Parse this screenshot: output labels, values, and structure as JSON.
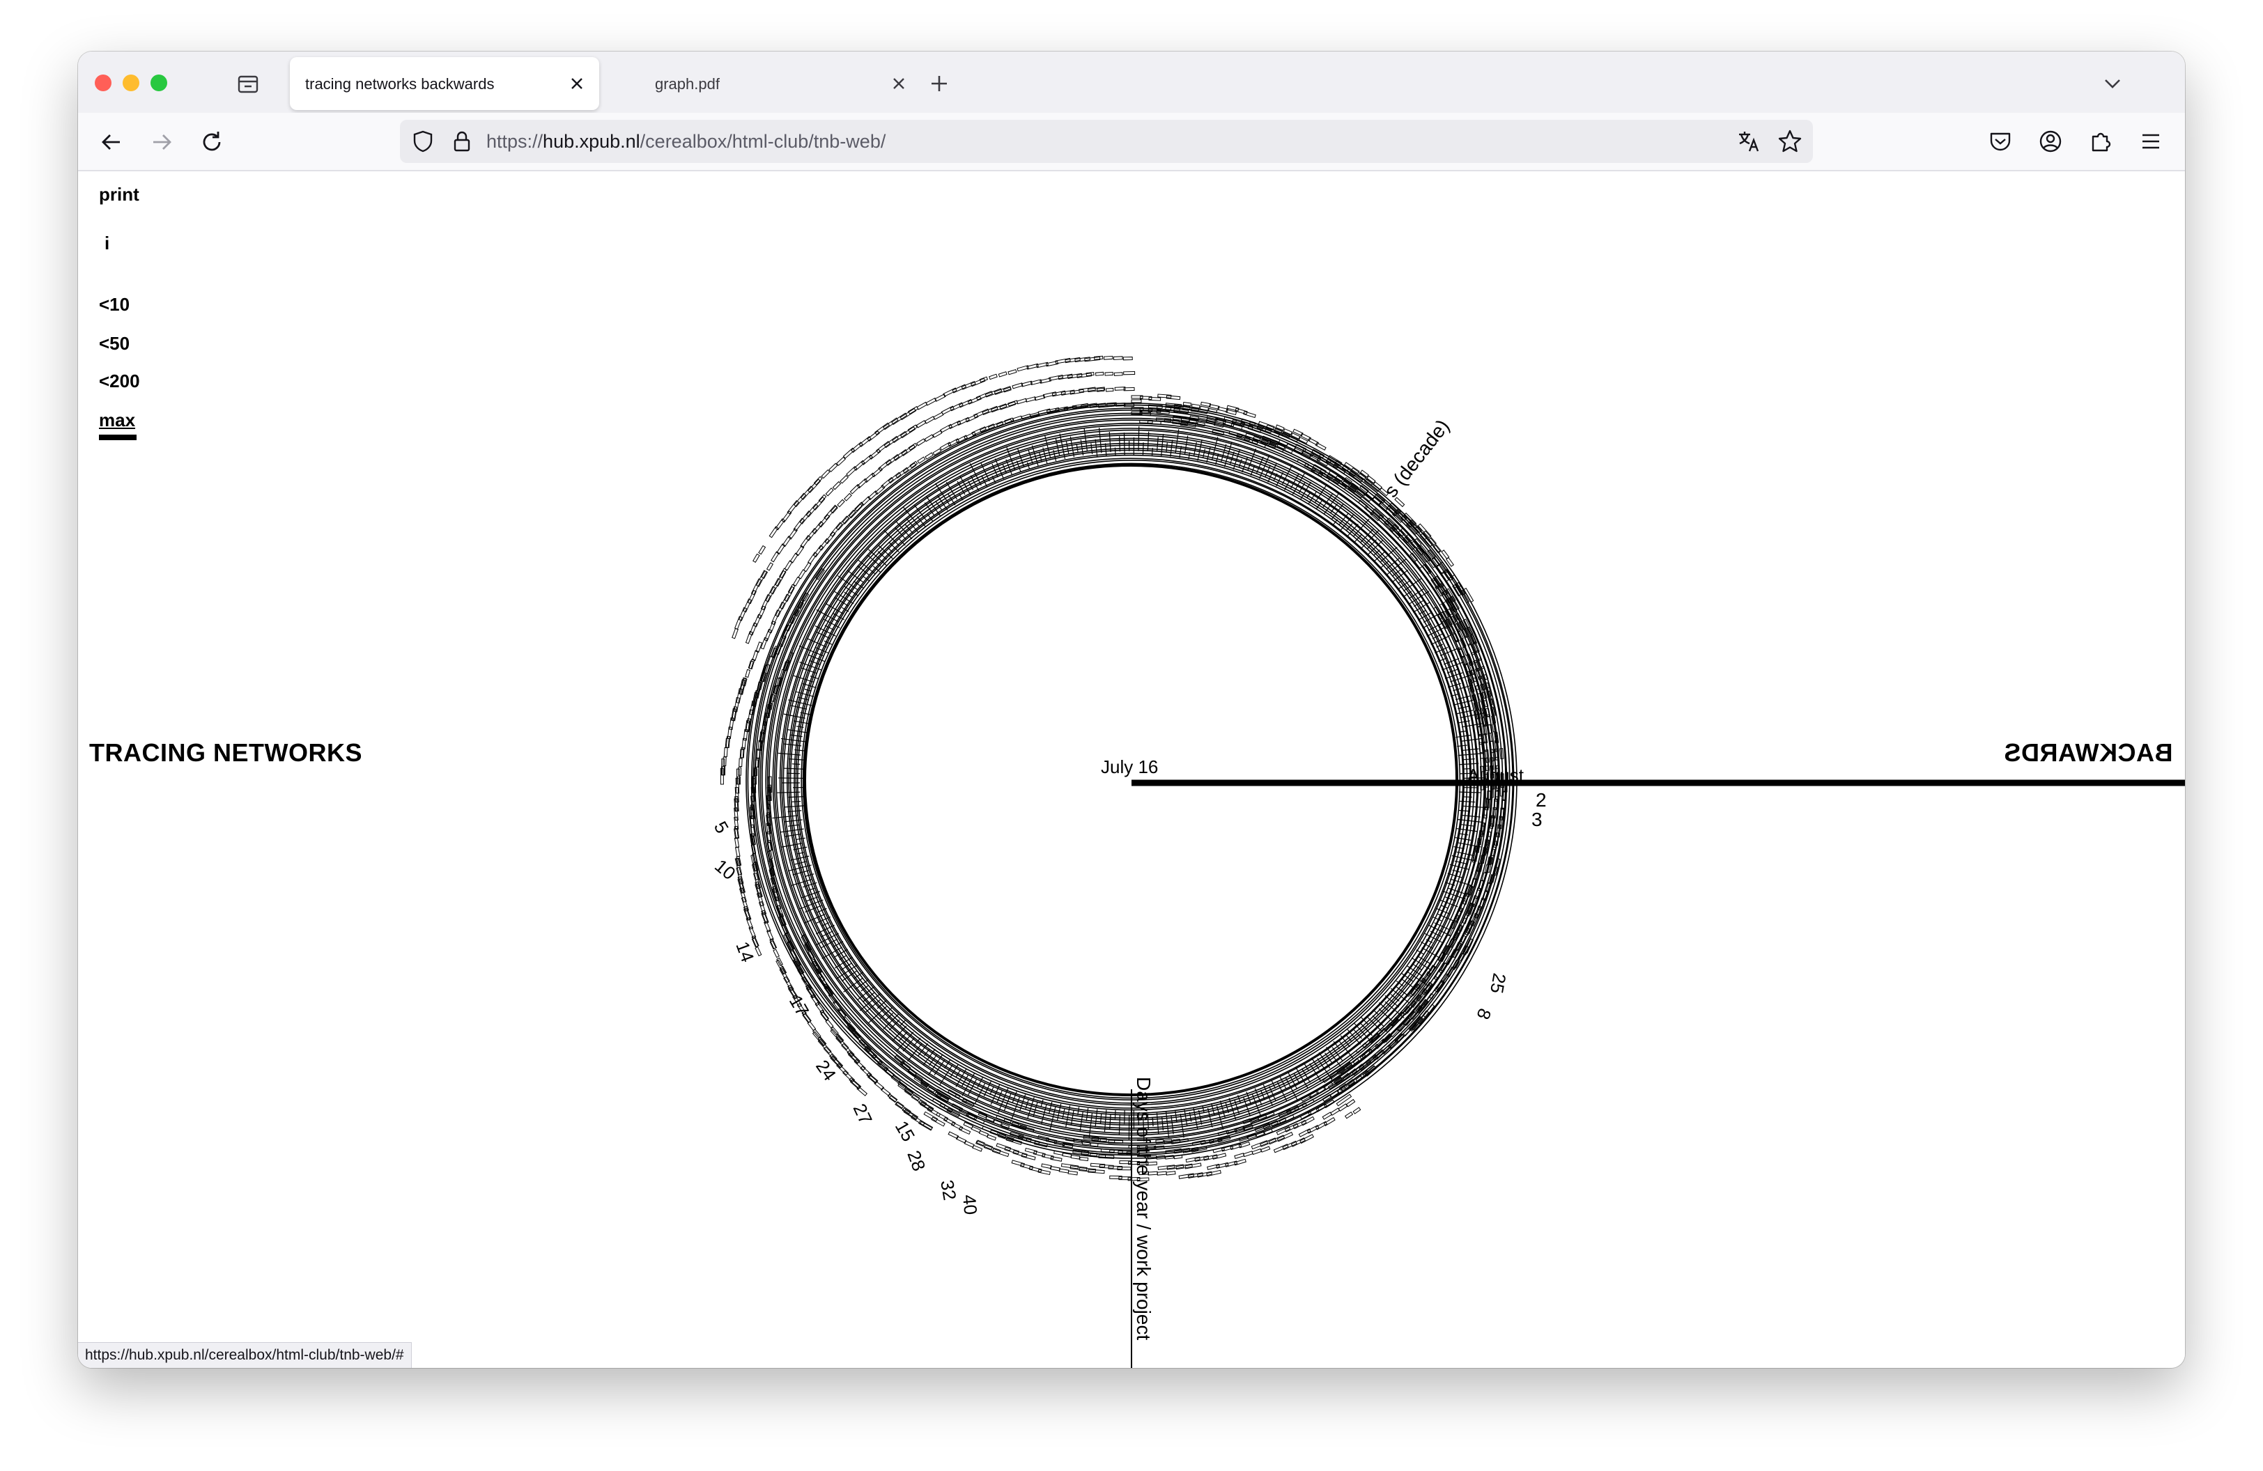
{
  "browser": {
    "tabs": [
      {
        "label": "tracing networks backwards",
        "active": true
      },
      {
        "label": "graph.pdf",
        "active": false
      }
    ],
    "url": {
      "scheme": "https://",
      "host": "hub.xpub.nl",
      "path": "/cerealbox/html-club/tnb-web/"
    },
    "status_url": "https://hub.xpub.nl/cerealbox/html-club/tnb-web/#",
    "icons": {
      "overview": "tab-overview-icon",
      "new_tab": "plus-icon",
      "tab_list": "chevron-down-icon",
      "back": "arrow-left-icon",
      "forward": "arrow-right-icon",
      "reload": "reload-icon",
      "shield": "shield-icon",
      "lock": "lock-icon",
      "translate": "translate-icon",
      "bookmark": "star-icon",
      "pocket": "pocket-icon",
      "account": "account-icon",
      "extensions": "puzzle-icon",
      "menu": "hamburger-icon"
    },
    "colors": {
      "close": "#ff5f57",
      "minimize": "#febc2e",
      "maximize": "#28c840"
    }
  },
  "page": {
    "menu": {
      "print": "print",
      "info": "i",
      "lt10": "<10",
      "lt50": "<50",
      "lt200": "<200",
      "max": "max"
    },
    "title_left": "TRACING NETWORKS",
    "title_right": "BACKWARDS",
    "graph": {
      "center_label": "July 16",
      "east_label": "August",
      "decade_label": "s (decade)",
      "south_label": "Days of the year / work project",
      "east_numbers": [
        "2",
        "3"
      ],
      "scattered_numbers": [
        "5",
        "10",
        "14",
        "17",
        "24",
        "27",
        "15",
        "28",
        "32",
        "40",
        "8",
        "25"
      ]
    }
  }
}
